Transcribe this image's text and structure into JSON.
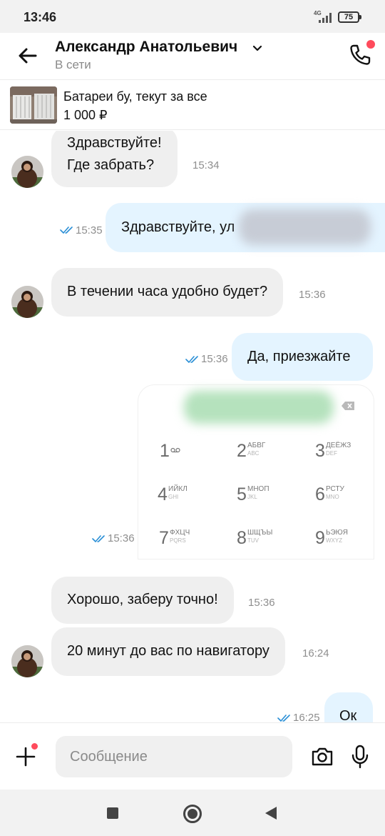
{
  "status_bar": {
    "time": "13:46",
    "network": "4G",
    "battery": "75"
  },
  "header": {
    "contact_name": "Александр Анатольевич",
    "status": "В сети"
  },
  "listing": {
    "title": "Батареи бу, текут за все",
    "price": "1 000 ₽"
  },
  "messages": [
    {
      "direction": "incoming",
      "lines": [
        "Здравствуйте!",
        "Где забрать?"
      ],
      "time": "15:34"
    },
    {
      "direction": "outgoing",
      "text": "Здравствуйте, ул",
      "time": "15:35",
      "read": true,
      "redacted_tail": true
    },
    {
      "direction": "incoming",
      "text": "В течении часа удобно будет?",
      "time": "15:36"
    },
    {
      "direction": "outgoing",
      "text": "Да, приезжайте",
      "time": "15:36",
      "read": true
    },
    {
      "direction": "outgoing",
      "type": "image",
      "time": "15:36",
      "read": true
    },
    {
      "direction": "incoming",
      "text": "Хорошо, заберу точно!",
      "time": "15:36"
    },
    {
      "direction": "incoming",
      "text": "20 минут до вас по навигатору",
      "time": "16:24"
    },
    {
      "direction": "outgoing",
      "text": "Ок",
      "time": "16:25",
      "read": true
    }
  ],
  "dialer_keys": [
    {
      "digit": "1",
      "letters": "",
      "latin": ""
    },
    {
      "digit": "2",
      "letters": "АБВГ",
      "latin": "ABC"
    },
    {
      "digit": "3",
      "letters": "ДЕЁЖЗ",
      "latin": "DEF"
    },
    {
      "digit": "4",
      "letters": "ИЙКЛ",
      "latin": "GHI"
    },
    {
      "digit": "5",
      "letters": "МНОП",
      "latin": "JKL"
    },
    {
      "digit": "6",
      "letters": "РСТУ",
      "latin": "MNO"
    },
    {
      "digit": "7",
      "letters": "ФХЦЧ",
      "latin": "PQRS"
    },
    {
      "digit": "8",
      "letters": "ШЩЪЫ",
      "latin": "TUV"
    },
    {
      "digit": "9",
      "letters": "ЬЭЮЯ",
      "latin": "WXYZ"
    }
  ],
  "composer": {
    "placeholder": "Сообщение"
  },
  "icons": {
    "back": "arrow-left-icon",
    "chevron": "chevron-down-icon",
    "call": "phone-icon",
    "ticks": "double-check-icon",
    "plus": "plus-icon",
    "camera": "camera-icon",
    "mic": "microphone-icon",
    "voicemail": "voicemail-icon",
    "backspace": "backspace-icon"
  },
  "colors": {
    "incoming_bubble": "#efefef",
    "outgoing_bubble": "#e4f4ff",
    "read_ticks": "#2a8fd6",
    "notification_dot": "#ff4b5c"
  }
}
